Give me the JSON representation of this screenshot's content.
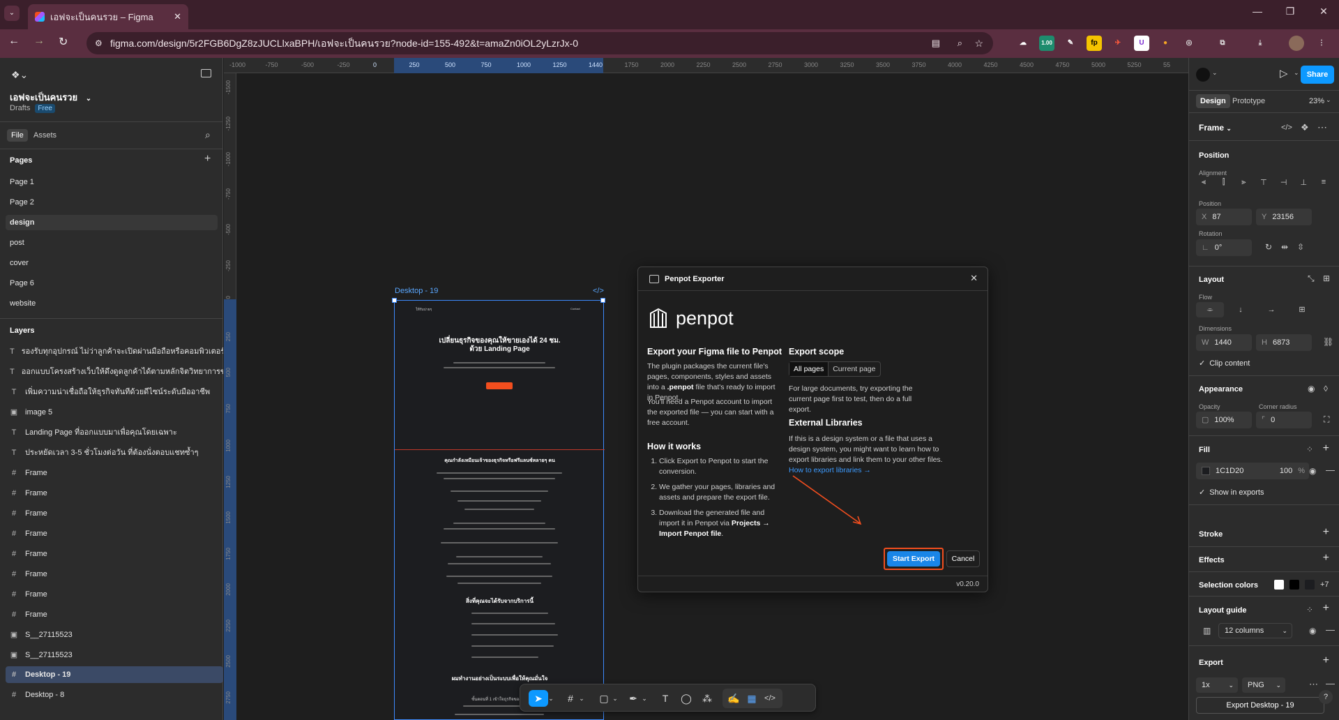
{
  "browser": {
    "tab_title": "เอฟจะเป็นคนรวย – Figma",
    "url": "figma.com/design/5r2FGB6DgZ8zJUCLlxaBPH/เอฟจะเป็นคนรวย?node-id=155-492&t=amaZn0iOL2yLzrJx-0",
    "ext_badge": "1.00"
  },
  "file": {
    "name": "เอฟจะเป็นคนรวย",
    "location": "Drafts",
    "plan_badge": "Free",
    "tabs": [
      "File",
      "Assets"
    ]
  },
  "pages": {
    "title": "Pages",
    "items": [
      "Page 1",
      "Page 2",
      "design",
      "post",
      "cover",
      "Page 6",
      "website"
    ],
    "active": "design"
  },
  "layers": {
    "title": "Layers",
    "items": [
      {
        "icon": "T",
        "name": "รองรับทุกอุปกรณ์ ไม่ว่าลูกค้าจะเปิดผ่านมือถือหรือคอมพิวเตอร์ ก็สวยงาม"
      },
      {
        "icon": "T",
        "name": "ออกแบบโครงสร้างเว็บให้ดึงดูดลูกค้าได้ตามหลักจิตวิทยาการขาย"
      },
      {
        "icon": "T",
        "name": "เพิ่มความน่าเชื่อถือให้ธุรกิจทันทีด้วยดีไซน์ระดับมืออาชีพ"
      },
      {
        "icon": "img",
        "name": "image 5"
      },
      {
        "icon": "T",
        "name": "Landing Page ที่ออกแบบมาเพื่อคุณโดยเฉพาะ"
      },
      {
        "icon": "T",
        "name": "ประหยัดเวลา 3-5 ชั่วโมงต่อวัน ที่ต้องนั่งตอบแชทซ้ำๆ"
      },
      {
        "icon": "#",
        "name": "Frame"
      },
      {
        "icon": "#",
        "name": "Frame"
      },
      {
        "icon": "#",
        "name": "Frame"
      },
      {
        "icon": "#",
        "name": "Frame"
      },
      {
        "icon": "#",
        "name": "Frame"
      },
      {
        "icon": "#",
        "name": "Frame"
      },
      {
        "icon": "#",
        "name": "Frame"
      },
      {
        "icon": "#",
        "name": "Frame"
      },
      {
        "icon": "img",
        "name": "S__27115523"
      },
      {
        "icon": "img",
        "name": "S__27115523"
      },
      {
        "icon": "#",
        "name": "Desktop - 19"
      },
      {
        "icon": "#",
        "name": "Desktop - 8"
      }
    ],
    "selected": "Desktop - 19"
  },
  "ruler": {
    "h_ticks": [
      "-1000",
      "-750",
      "-500",
      "-250",
      "0",
      "250",
      "500",
      "750",
      "1000",
      "1250",
      "1440",
      "1750",
      "2000",
      "2250",
      "2500",
      "2750",
      "3000",
      "3250",
      "3500",
      "3750",
      "4000",
      "4250",
      "4500",
      "4750",
      "5000",
      "5250",
      "55"
    ],
    "v_ticks": [
      "-1500",
      "-1250",
      "-1000",
      "-750",
      "-500",
      "-250",
      "0",
      "250",
      "500",
      "750",
      "1000",
      "1250",
      "1500",
      "1750",
      "2000",
      "2250",
      "2500",
      "2750"
    ]
  },
  "frame_preview": {
    "label": "Desktop - 19",
    "logo": "ให้รับบ่ายๆ",
    "nav": "Contact",
    "hero_title_1": "เปลี่ยนธุรกิจของคุณให้ขายเองได้ 24 ชม.",
    "hero_title_2": "ด้วย Landing Page",
    "section2_title": "คุณกำลังเหมือนเจ้าของธุรกิจหรือฟรีแลนซ์หลายๆ คน",
    "section3_title": "สิ่งที่คุณจะได้รับจากบริการนี้",
    "section4_title": "ผมทำงานอย่างเป็นระบบเพื่อให้คุณมั่นใจ",
    "section4_sub": "ขั้นตอนที่ 1 เข้าใจธุรกิจของคุณ"
  },
  "dialog": {
    "title": "Penpot Exporter",
    "brand": "penpot",
    "left_heading": "Export your Figma file to Penpot",
    "left_p1_a": "The plugin packages the current file's pages, components, styles and assets into a ",
    "left_p1_code": ".penpot",
    "left_p1_b": " file that's ready to import in Penpot.",
    "left_p2": "You'll need a Penpot account to import the exported file — you can start with a free account.",
    "how_heading": "How it works",
    "steps": [
      "Click Export to Penpot to start the conversion.",
      "We gather your pages, libraries and assets and prepare the export file.",
      "Download the generated file and import it in Penpot via "
    ],
    "step3_bold": "Projects → Import Penpot file",
    "step3_end": ".",
    "scope_heading": "Export scope",
    "scope_options": [
      "All pages",
      "Current page"
    ],
    "scope_note": "For large documents, try exporting the current page first to test, then do a full export.",
    "ext_heading": "External Libraries",
    "ext_text": "If this is a design system or a file that uses a design system, you might want to learn how to export libraries and link them to your other files.",
    "ext_link": "How to export libraries →",
    "start_button": "Start Export",
    "cancel_button": "Cancel",
    "version": "v0.20.0"
  },
  "right": {
    "tabs": [
      "Design",
      "Prototype"
    ],
    "zoom": "23%",
    "share": "Share",
    "node_type": "Frame",
    "position_title": "Position",
    "alignment_label": "Alignment",
    "position_label": "Position",
    "x_label": "X",
    "x": "87",
    "y_label": "Y",
    "y": "23156",
    "rotation_label": "Rotation",
    "rotation": "0°",
    "layout_title": "Layout",
    "flow_label": "Flow",
    "dimensions_label": "Dimensions",
    "w_label": "W",
    "w": "1440",
    "h_label": "H",
    "h": "6873",
    "clip": "Clip content",
    "appearance_title": "Appearance",
    "opacity_label": "Opacity",
    "opacity": "100%",
    "radius_label": "Corner radius",
    "radius": "0",
    "fill_title": "Fill",
    "fill_hex": "1C1D20",
    "fill_opacity": "100",
    "fill_pct": "%",
    "fill_color": "#1C1D20",
    "show_exports": "Show in exports",
    "stroke_title": "Stroke",
    "effects_title": "Effects",
    "selection_colors_title": "Selection colors",
    "selection_more": "+7",
    "layout_guide_title": "Layout guide",
    "guide_value": "12 columns",
    "export_title": "Export",
    "export_scale": "1x",
    "export_format": "PNG",
    "export_button": "Export Desktop - 19"
  },
  "colors": {
    "accent": "#0d99ff",
    "highlight": "#f24e1e",
    "browser_bg": "#3b1f2b"
  }
}
